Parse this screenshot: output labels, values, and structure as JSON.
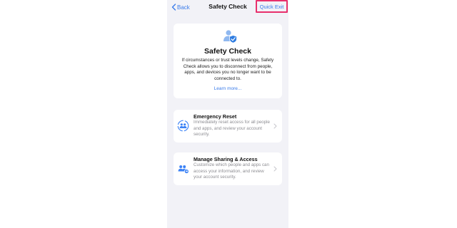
{
  "nav": {
    "back_label": "Back",
    "title": "Safety Check",
    "quick_exit_label": "Quick Exit"
  },
  "hero": {
    "icon": "person-shield-icon",
    "title": "Safety Check",
    "description": "If circumstances or trust levels change, Safety Check allows you to disconnect from people, apps, and devices you no longer want to be connected to.",
    "learn_more": "Learn more..."
  },
  "options": [
    {
      "icon": "people-reset-icon",
      "title": "Emergency Reset",
      "description": "Immediately reset access for all people and apps, and review your account security."
    },
    {
      "icon": "people-manage-icon",
      "title": "Manage Sharing & Access",
      "description": "Customize which people and apps can access your information, and review your account security."
    }
  ],
  "colors": {
    "accent": "#3a7bea",
    "highlight_border": "#e8306c",
    "background": "#f2f2f7",
    "icon_blue": "#3b82f6"
  }
}
